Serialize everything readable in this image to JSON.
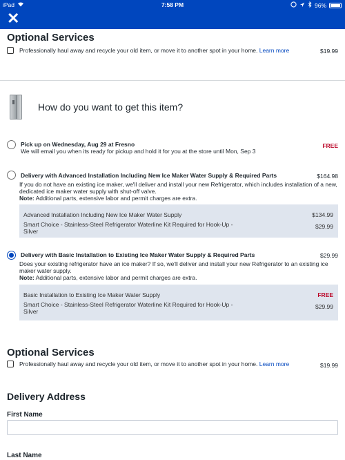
{
  "status_bar": {
    "device": "iPad",
    "time": "7:58 PM",
    "battery": "96%"
  },
  "header": {
    "close_icon": "close-icon"
  },
  "optional_services_top": {
    "title": "Optional Services",
    "haul_text": "Professionally haul away and recycle your old item, or move it to another spot in your home.",
    "learn_more": "Learn more",
    "price": "$19.99"
  },
  "fulfillment": {
    "question": "How do you want to get this item?"
  },
  "options": [
    {
      "title": "Pick up on Wednesday, Aug 29 at Fresno",
      "desc": "We will email you when its ready for pickup and hold it for you at the store until Mon, Sep 3",
      "price": "FREE"
    },
    {
      "title": "Delivery with Advanced Installation Including New Ice Maker Water Supply & Required Parts",
      "price": "$164.98",
      "desc": "If you do not have an existing ice maker, we'll deliver and install your new Refrigerator, which includes installation of a new, dedicated ice maker water supply with shut-off valve.",
      "note_label": "Note:",
      "note_text": " Additional parts, extensive labor and permit charges are extra.",
      "details": [
        {
          "name": "Advanced Installation Including New Ice Maker Water Supply",
          "price": "$134.99"
        },
        {
          "name": "Smart Choice - Stainless-Steel Refrigerator Waterline Kit Required for Hook-Up - Silver",
          "price": "$29.99"
        }
      ]
    },
    {
      "title": "Delivery with Basic Installation to Existing Ice Maker Water Supply & Required Parts",
      "price": "$29.99",
      "desc": "Does your existing refrigerator have an ice maker? If so, we'll deliver and install your new Refrigerator to an existing ice maker water supply.",
      "note_label": "Note:",
      "note_text": " Additional parts, extensive labor and permit charges are extra.",
      "details": [
        {
          "name": "Basic Installation to Existing Ice Maker Water Supply",
          "price": "FREE"
        },
        {
          "name": "Smart Choice - Stainless-Steel Refrigerator Waterline Kit Required for Hook-Up - Silver",
          "price": "$29.99"
        }
      ],
      "selected": true
    }
  ],
  "optional_services_bottom": {
    "title": "Optional Services",
    "haul_text": "Professionally haul away and recycle your old item, or move it to another spot in your home.",
    "learn_more": "Learn more",
    "price": "$19.99"
  },
  "delivery_address": {
    "title": "Delivery Address",
    "first_name_label": "First Name",
    "first_name_value": "",
    "last_name_label": "Last Name"
  },
  "colors": {
    "brand_blue": "#0046be",
    "free_red": "#bb0628",
    "detail_bg": "#dfe5ee"
  }
}
